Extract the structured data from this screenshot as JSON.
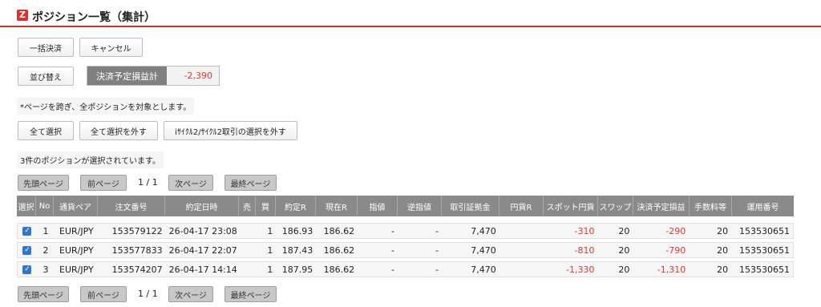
{
  "header": {
    "logo": "Z",
    "title": "ポジション一覧（集計）"
  },
  "buttons": {
    "bulk_settle": "一括決済",
    "cancel": "キャンセル",
    "sort": "並び替え",
    "select_all": "全て選択",
    "deselect_all": "全て選択を外す",
    "deselect_cycle": "iｻｲｸﾙ2/ｻｲｸﾙ2取引の選択を外す"
  },
  "pl_summary": {
    "label": "決済予定損益計",
    "value": "-2,390"
  },
  "notes": {
    "page_note": "*ページを跨ぎ、全ポジションを対象とします。",
    "selected_count": "3件のポジションが選択されています。"
  },
  "pager": {
    "first": "先頭ページ",
    "prev": "前ページ",
    "position": "1 / 1",
    "next": "次ページ",
    "last": "最終ページ"
  },
  "table": {
    "headers": [
      "選択",
      "No",
      "通貨ペア",
      "注文番号",
      "約定日時",
      "売",
      "買",
      "約定R",
      "現在R",
      "指値",
      "逆指値",
      "取引証拠金",
      "円貨R",
      "スポット円貨",
      "スワップ",
      "決済予定損益",
      "手数料等",
      "運用番号"
    ],
    "rows": [
      {
        "no": "1",
        "pair": "EUR/JPY",
        "order_no": "153579122",
        "datetime": "26-04-17 23:08",
        "sell": "",
        "buy": "1",
        "exec_rate": "186.93",
        "current_rate": "186.62",
        "limit": "-",
        "stop": "-",
        "margin": "7,470",
        "yen_rate": "",
        "spot_yen": "-310",
        "swap": "20",
        "pl": "-290",
        "fee": "20",
        "op_no": "153530651"
      },
      {
        "no": "2",
        "pair": "EUR/JPY",
        "order_no": "153577833",
        "datetime": "26-04-17 22:07",
        "sell": "",
        "buy": "1",
        "exec_rate": "187.43",
        "current_rate": "186.62",
        "limit": "-",
        "stop": "-",
        "margin": "7,470",
        "yen_rate": "",
        "spot_yen": "-810",
        "swap": "20",
        "pl": "-790",
        "fee": "20",
        "op_no": "153530651"
      },
      {
        "no": "3",
        "pair": "EUR/JPY",
        "order_no": "153574207",
        "datetime": "26-04-17 14:14",
        "sell": "",
        "buy": "1",
        "exec_rate": "187.95",
        "current_rate": "186.62",
        "limit": "-",
        "stop": "-",
        "margin": "7,470",
        "yen_rate": "",
        "spot_yen": "-1,330",
        "swap": "20",
        "pl": "-1,310",
        "fee": "20",
        "op_no": "153530651"
      }
    ]
  },
  "colors": {
    "accent_red": "#d63a34",
    "header_rule": "#c0392b",
    "table_header": "#8a8a8a",
    "checkbox": "#2f76d4"
  }
}
